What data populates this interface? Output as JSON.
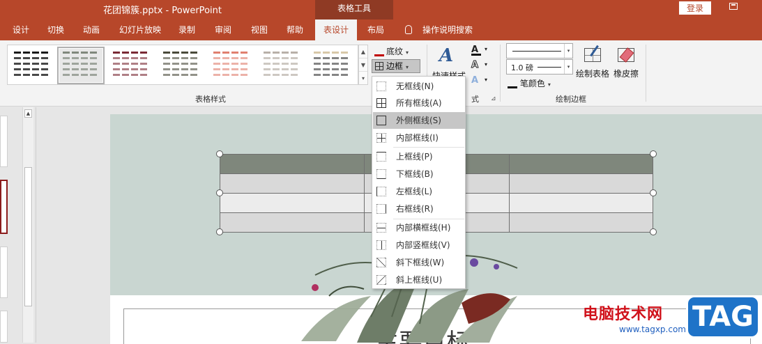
{
  "window": {
    "title": "花团锦簇.pptx  -  PowerPoint",
    "context_tools": "表格工具",
    "login": "登录"
  },
  "tabs": [
    {
      "label": "设计"
    },
    {
      "label": "切换"
    },
    {
      "label": "动画"
    },
    {
      "label": "幻灯片放映"
    },
    {
      "label": "录制"
    },
    {
      "label": "审阅"
    },
    {
      "label": "视图"
    },
    {
      "label": "帮助"
    },
    {
      "label": "表设计",
      "active": true
    },
    {
      "label": "布局"
    },
    {
      "label": "操作说明搜索"
    }
  ],
  "ribbon": {
    "table_styles_label": "表格样式",
    "shading_label": "底纹",
    "borders_label": "边框",
    "quick_styles_label": "快速样式",
    "art_group_tail": "式",
    "pen_weight": "1.0 磅",
    "pen_color_label": "笔颜色",
    "draw_table_label": "绘制表格",
    "eraser_label": "橡皮擦",
    "draw_borders_label": "绘制边框",
    "style_colors": [
      "#000000",
      "#7f877c",
      "#7a2a35",
      "#4a4a3a",
      "#e07f6f",
      "#b8b0a8",
      "#e8dcc8"
    ]
  },
  "border_menu": {
    "items": [
      {
        "label": "无框线(N)"
      },
      {
        "label": "所有框线(A)"
      },
      {
        "label": "外侧框线(S)",
        "highlighted": true
      },
      {
        "label": "内部框线(I)"
      },
      {
        "label": "上框线(P)"
      },
      {
        "label": "下框线(B)"
      },
      {
        "label": "左框线(L)"
      },
      {
        "label": "右框线(R)"
      },
      {
        "label": "内部横框线(H)"
      },
      {
        "label": "内部竖框线(V)"
      },
      {
        "label": "斜下框线(W)"
      },
      {
        "label": "斜上框线(U)"
      }
    ]
  },
  "slide": {
    "title_partial": "主要目标"
  },
  "watermark": {
    "site_name": "电脑技术网",
    "url": "www.tagxp.com",
    "badge": "TAG"
  },
  "colors": {
    "accent": "#b7472a",
    "header_row": "#7f877c",
    "slide_bg": "#c9d6d1"
  }
}
